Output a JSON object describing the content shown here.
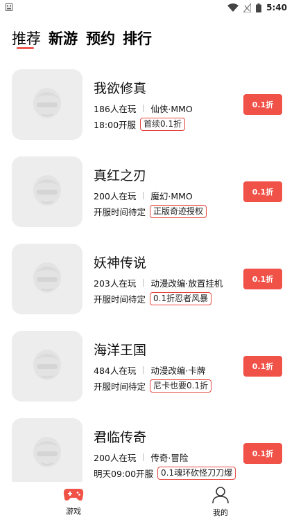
{
  "status_bar": {
    "time": "5:40",
    "icons": [
      "notification-icon",
      "wifi-icon",
      "signal-icon",
      "battery-icon"
    ]
  },
  "tabs": [
    {
      "label": "推荐",
      "active": true
    },
    {
      "label": "新游",
      "active": false
    },
    {
      "label": "预约",
      "active": false
    },
    {
      "label": "排行",
      "active": false
    }
  ],
  "accent_color": "#f05248",
  "games": [
    {
      "name": "我欲修真",
      "players": "186人在玩",
      "genre": "仙侠·MMO",
      "server": "18:00开服",
      "tag": "首续0.1折",
      "button": "0.1折"
    },
    {
      "name": "真红之刃",
      "players": "200人在玩",
      "genre": "魔幻·MMO",
      "server": "开服时间待定",
      "tag": "正版奇迹授权",
      "button": "0.1折"
    },
    {
      "name": "妖神传说",
      "players": "203人在玩",
      "genre": "动漫改编·放置挂机",
      "server": "开服时间待定",
      "tag": "0.1折忍者风暴",
      "button": "0.1折"
    },
    {
      "name": "海洋王国",
      "players": "484人在玩",
      "genre": "动漫改编·卡牌",
      "server": "开服时间待定",
      "tag": "尼卡也要0.1折",
      "button": "0.1折"
    },
    {
      "name": "君临传奇",
      "players": "200人在玩",
      "genre": "传奇·冒险",
      "server": "明天09:00开服",
      "tag": "0.1魂环砍怪刀刀爆",
      "button": "0.1折"
    }
  ],
  "bottom_nav": [
    {
      "label": "游戏",
      "icon": "gamepad-icon",
      "active": true
    },
    {
      "label": "我的",
      "icon": "user-icon",
      "active": false
    }
  ]
}
